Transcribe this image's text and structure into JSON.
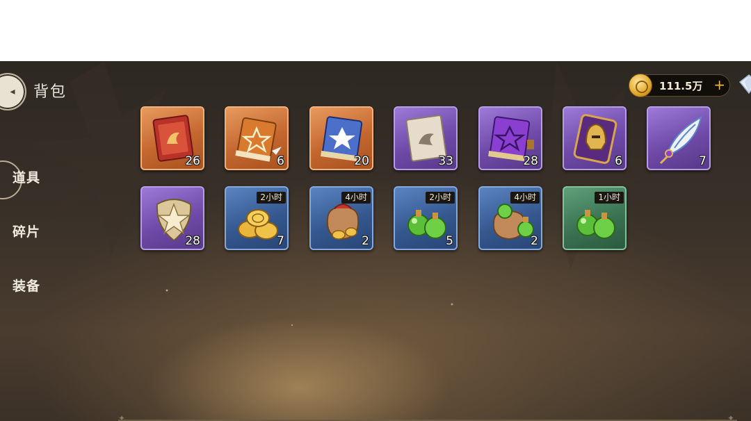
{
  "header": {
    "title": "背包",
    "gold_amount": "111.5万",
    "gold_add_symbol": "+"
  },
  "tabs": [
    {
      "label": "道具",
      "active": true
    },
    {
      "label": "碎片",
      "active": false
    },
    {
      "label": "装备",
      "active": false
    }
  ],
  "items": [
    {
      "name": "red-scroll",
      "rarity": "orange",
      "count": "26",
      "time": ""
    },
    {
      "name": "orange-star-book",
      "rarity": "orange",
      "count": "6",
      "time": ""
    },
    {
      "name": "blue-crystal-book",
      "rarity": "orange",
      "count": "20",
      "time": ""
    },
    {
      "name": "parchment-scroll",
      "rarity": "purple",
      "count": "33",
      "time": ""
    },
    {
      "name": "purple-star-book",
      "rarity": "purple",
      "count": "28",
      "time": ""
    },
    {
      "name": "helmet-card",
      "rarity": "purple",
      "count": "6",
      "time": ""
    },
    {
      "name": "feather-quill",
      "rarity": "purple",
      "count": "7",
      "time": ""
    },
    {
      "name": "star-shield",
      "rarity": "purple",
      "count": "28",
      "time": ""
    },
    {
      "name": "gold-coin-pile",
      "rarity": "blue",
      "count": "7",
      "time": "2小时"
    },
    {
      "name": "gold-coin-bag",
      "rarity": "blue",
      "count": "2",
      "time": "4小时"
    },
    {
      "name": "green-potion-bottles",
      "rarity": "blue",
      "count": "5",
      "time": "2小时"
    },
    {
      "name": "potion-bag",
      "rarity": "blue",
      "count": "2",
      "time": "4小时"
    },
    {
      "name": "green-potion-bottles-small",
      "rarity": "green",
      "count": "",
      "time": "1小时"
    }
  ],
  "colors": {
    "orange_frame": "#c4672f",
    "purple_frame": "#6f4aa8",
    "blue_frame": "#35588f",
    "green_frame": "#3b7353"
  }
}
